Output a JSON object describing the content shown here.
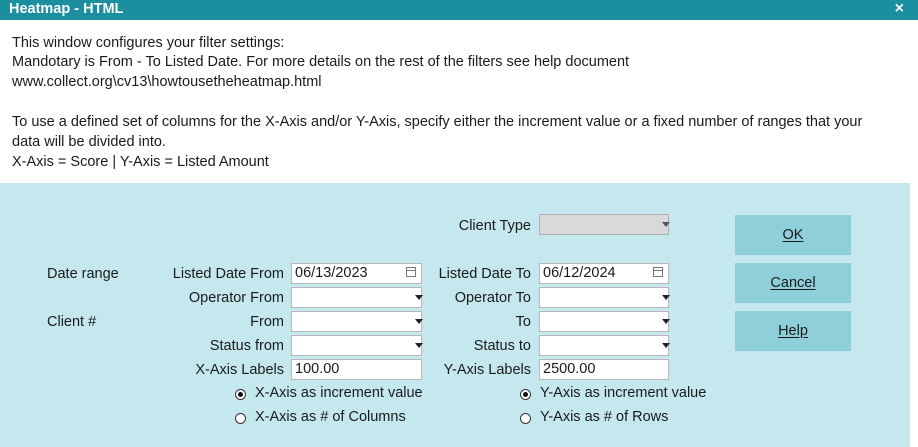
{
  "window": {
    "title": "Heatmap - HTML",
    "close_symbol": "×"
  },
  "info": {
    "line1": "This window configures your filter settings:",
    "line2": "Mandotary is From - To Listed Date. For more details on the rest of the filters see help document",
    "line3": "www.collect.org\\cv13\\howtousetheheatmap.html",
    "line4": "To use a defined set of columns for the X-Axis and/or Y-Axis, specify either the increment value or a fixed number of ranges that your",
    "line5": "data will be divided into.",
    "line6": "X-Axis = Score  |  Y-Axis = Listed Amount"
  },
  "form": {
    "client_type_label": "Client Type",
    "client_type_value": "",
    "date_range_label": "Date range",
    "listed_date_from_label": "Listed Date From",
    "listed_date_from_value": "06/13/2023",
    "listed_date_to_label": "Listed Date To",
    "listed_date_to_value": "06/12/2024",
    "operator_from_label": "Operator From",
    "operator_from_value": "",
    "operator_to_label": "Operator To",
    "operator_to_value": "",
    "client_num_label": "Client #",
    "client_from_label": "From",
    "client_from_value": "",
    "client_to_label": "To",
    "client_to_value": "",
    "status_from_label": "Status from",
    "status_from_value": "",
    "status_to_label": "Status to",
    "status_to_value": "",
    "x_axis_labels_label": "X-Axis Labels",
    "x_axis_labels_value": "100.00",
    "y_axis_labels_label": "Y-Axis Labels",
    "y_axis_labels_value": "2500.00",
    "x_increment_label": "X-Axis as increment value",
    "x_increment_selected": true,
    "x_columns_label": "X-Axis as # of Columns",
    "x_columns_selected": false,
    "y_increment_label": "Y-Axis as increment value",
    "y_increment_selected": true,
    "y_rows_label": "Y-Axis as # of Rows",
    "y_rows_selected": false
  },
  "buttons": {
    "ok": "OK",
    "cancel": "Cancel",
    "help": "Help"
  },
  "colors": {
    "titlebar": "#1b8fa0",
    "dialog_bg": "#c5e8ef",
    "button": "#8fcfda"
  },
  "icons": {
    "dropdown": "chevron-down-icon",
    "calendar": "calendar-icon",
    "close": "close-icon"
  }
}
